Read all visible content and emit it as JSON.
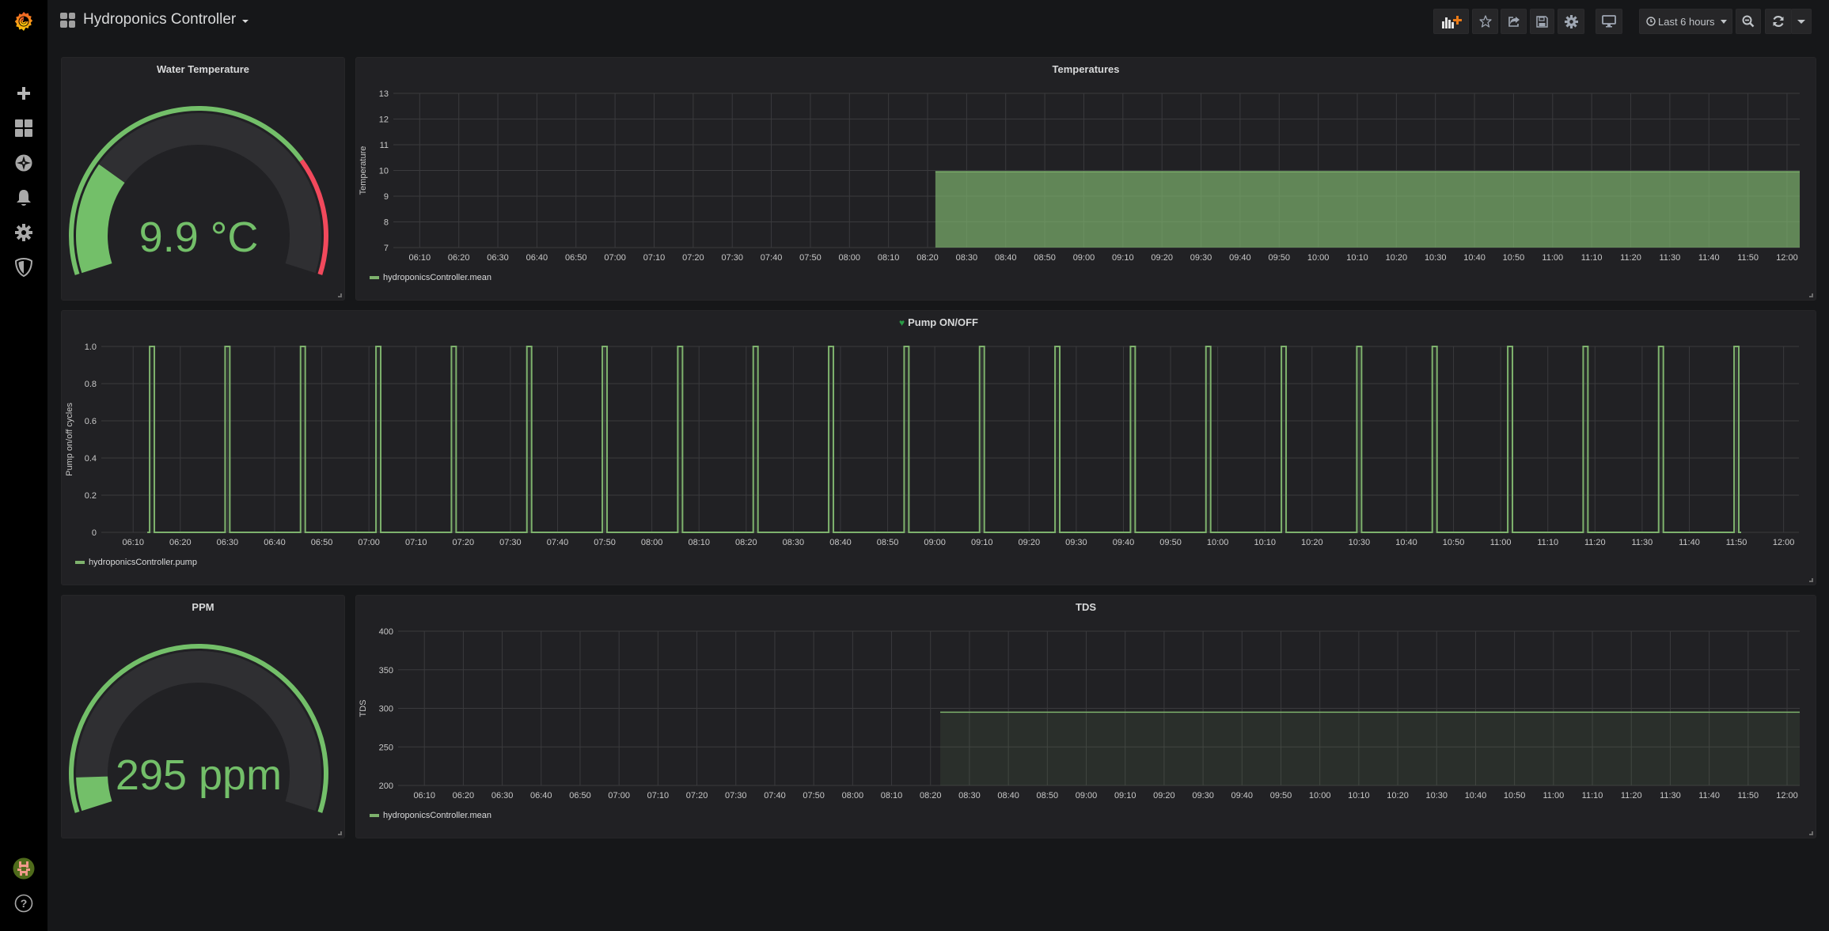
{
  "app": {
    "dashboard_title": "Hydroponics Controller",
    "sidebar": {
      "top_items": [
        {
          "icon": "grafana-logo-icon",
          "label": "Home"
        },
        {
          "icon": "plus-icon",
          "label": "Create"
        },
        {
          "icon": "dashboards-grid-icon",
          "label": "Dashboards"
        },
        {
          "icon": "compass-explore-icon",
          "label": "Explore"
        },
        {
          "icon": "bell-alerting-icon",
          "label": "Alerting"
        },
        {
          "icon": "gear-configuration-icon",
          "label": "Configuration"
        },
        {
          "icon": "shield-admin-icon",
          "label": "Server Admin"
        }
      ],
      "bottom_items": [
        {
          "icon": "user-avatar-icon",
          "label": "Profile"
        },
        {
          "icon": "help-question-icon",
          "label": "Help"
        }
      ]
    },
    "toolbar": {
      "add_panel": "Add panel",
      "star": "Mark as favorite",
      "share": "Share dashboard",
      "save": "Save dashboard",
      "settings": "Settings",
      "tv_mode": "Cycle view mode",
      "time_range": "Last 6 hours",
      "zoom_out": "Zoom out time range",
      "refresh": "Refresh dashboard",
      "refresh_interval": "Refresh interval"
    },
    "colors": {
      "green": "#73bf69",
      "series_green": "#7eb26d",
      "red": "#f2495c",
      "alert_ok": "#299c46",
      "panel_bg": "#212124",
      "page_bg": "#161719"
    }
  },
  "panels": {
    "water_temperature": {
      "title": "Water Temperature",
      "value": 9.9,
      "display": "9.9 °C",
      "min": 0,
      "max": 40,
      "thresholds": [
        {
          "from": 0,
          "to": 30,
          "color": "#73bf69"
        },
        {
          "from": 30,
          "to": 40,
          "color": "#f2495c"
        }
      ]
    },
    "ppm": {
      "title": "PPM",
      "value": 295,
      "display": "295 ppm",
      "min": 0,
      "max": 4000,
      "thresholds": [
        {
          "from": 0,
          "to": 4000,
          "color": "#73bf69"
        }
      ]
    }
  },
  "chart_data": [
    {
      "id": "temperatures",
      "type": "area",
      "title": "Temperatures",
      "ylabel": "Temperature",
      "xlabel": "",
      "ylim": [
        7,
        13
      ],
      "yticks": [
        "13",
        "12",
        "11",
        "10",
        "9",
        "8",
        "7"
      ],
      "ytick_values": [
        13,
        12,
        11,
        10,
        9,
        8,
        7
      ],
      "xlim": [
        "06:03:15",
        "12:03:15"
      ],
      "xticks": [
        "06:10",
        "06:20",
        "06:30",
        "06:40",
        "06:50",
        "07:00",
        "07:10",
        "07:20",
        "07:30",
        "07:40",
        "07:50",
        "08:00",
        "08:10",
        "08:20",
        "08:30",
        "08:40",
        "08:50",
        "09:00",
        "09:10",
        "09:20",
        "09:30",
        "09:40",
        "09:50",
        "10:00",
        "10:10",
        "10:20",
        "10:30",
        "10:40",
        "10:50",
        "11:00",
        "11:10",
        "11:20",
        "11:30",
        "11:40",
        "11:50",
        "12:00"
      ],
      "grid": true,
      "legend": "bottom-left",
      "series": [
        {
          "name": "hydroponicsController.mean",
          "color": "#7eb26d",
          "fill": 0.7,
          "points": [
            [
              "08:22:00",
              9.95
            ],
            [
              "09:00:00",
              9.95
            ],
            [
              "10:00:00",
              9.95
            ],
            [
              "11:00:00",
              9.95
            ],
            [
              "12:03:15",
              9.95
            ]
          ]
        }
      ]
    },
    {
      "id": "pump",
      "type": "line",
      "title": "Pump ON/OFF",
      "alert_state": "ok",
      "ylabel": "Pump on/off cycles",
      "xlabel": "",
      "ylim": [
        0,
        1
      ],
      "yticks": [
        "1.0",
        "0.8",
        "0.6",
        "0.4",
        "0.2",
        "0"
      ],
      "ytick_values": [
        1,
        0.8,
        0.6,
        0.4,
        0.2,
        0
      ],
      "xlim": [
        "06:03:15",
        "12:03:15"
      ],
      "xticks": [
        "06:10",
        "06:20",
        "06:30",
        "06:40",
        "06:50",
        "07:00",
        "07:10",
        "07:20",
        "07:30",
        "07:40",
        "07:50",
        "08:00",
        "08:10",
        "08:20",
        "08:30",
        "08:40",
        "08:50",
        "09:00",
        "09:10",
        "09:20",
        "09:30",
        "09:40",
        "09:50",
        "10:00",
        "10:10",
        "10:20",
        "10:30",
        "10:40",
        "10:50",
        "11:00",
        "11:10",
        "11:20",
        "11:30",
        "11:40",
        "11:50",
        "12:00"
      ],
      "grid": true,
      "legend": "bottom-left",
      "series": [
        {
          "name": "hydroponicsController.pump",
          "color": "#7eb26d",
          "step": true,
          "series_start": "06:13:00",
          "series_end": "11:51:00",
          "on_intervals": [
            [
              "06:13:30",
              "06:14:30"
            ],
            [
              "06:29:30",
              "06:30:30"
            ],
            [
              "06:45:30",
              "06:46:30"
            ],
            [
              "07:01:30",
              "07:02:30"
            ],
            [
              "07:17:30",
              "07:18:30"
            ],
            [
              "07:33:30",
              "07:34:30"
            ],
            [
              "07:49:30",
              "07:50:30"
            ],
            [
              "08:05:30",
              "08:06:30"
            ],
            [
              "08:21:30",
              "08:22:30"
            ],
            [
              "08:37:30",
              "08:38:30"
            ],
            [
              "08:53:30",
              "08:54:30"
            ],
            [
              "09:09:30",
              "09:10:30"
            ],
            [
              "09:25:30",
              "09:26:30"
            ],
            [
              "09:41:30",
              "09:42:30"
            ],
            [
              "09:57:30",
              "09:58:30"
            ],
            [
              "10:13:30",
              "10:14:30"
            ],
            [
              "10:29:30",
              "10:30:30"
            ],
            [
              "10:45:30",
              "10:46:30"
            ],
            [
              "11:01:30",
              "11:02:30"
            ],
            [
              "11:17:30",
              "11:18:30"
            ],
            [
              "11:33:30",
              "11:34:30"
            ],
            [
              "11:49:30",
              "11:50:30"
            ]
          ]
        }
      ]
    },
    {
      "id": "tds",
      "type": "area",
      "title": "TDS",
      "ylabel": "TDS",
      "xlabel": "",
      "ylim": [
        200,
        400
      ],
      "yticks": [
        "400",
        "350",
        "300",
        "250",
        "200"
      ],
      "ytick_values": [
        400,
        350,
        300,
        250,
        200
      ],
      "xlim": [
        "06:03:15",
        "12:03:15"
      ],
      "xticks": [
        "06:10",
        "06:20",
        "06:30",
        "06:40",
        "06:50",
        "07:00",
        "07:10",
        "07:20",
        "07:30",
        "07:40",
        "07:50",
        "08:00",
        "08:10",
        "08:20",
        "08:30",
        "08:40",
        "08:50",
        "09:00",
        "09:10",
        "09:20",
        "09:30",
        "09:40",
        "09:50",
        "10:00",
        "10:10",
        "10:20",
        "10:30",
        "10:40",
        "10:50",
        "11:00",
        "11:10",
        "11:20",
        "11:30",
        "11:40",
        "11:50",
        "12:00"
      ],
      "grid": true,
      "legend": "bottom-left",
      "series": [
        {
          "name": "hydroponicsController.mean",
          "color": "#7eb26d",
          "fill": 0.1,
          "points": [
            [
              "08:22:30",
              295
            ],
            [
              "09:00:00",
              295
            ],
            [
              "10:00:00",
              295
            ],
            [
              "11:00:00",
              295
            ],
            [
              "12:03:15",
              295
            ]
          ]
        }
      ]
    }
  ]
}
